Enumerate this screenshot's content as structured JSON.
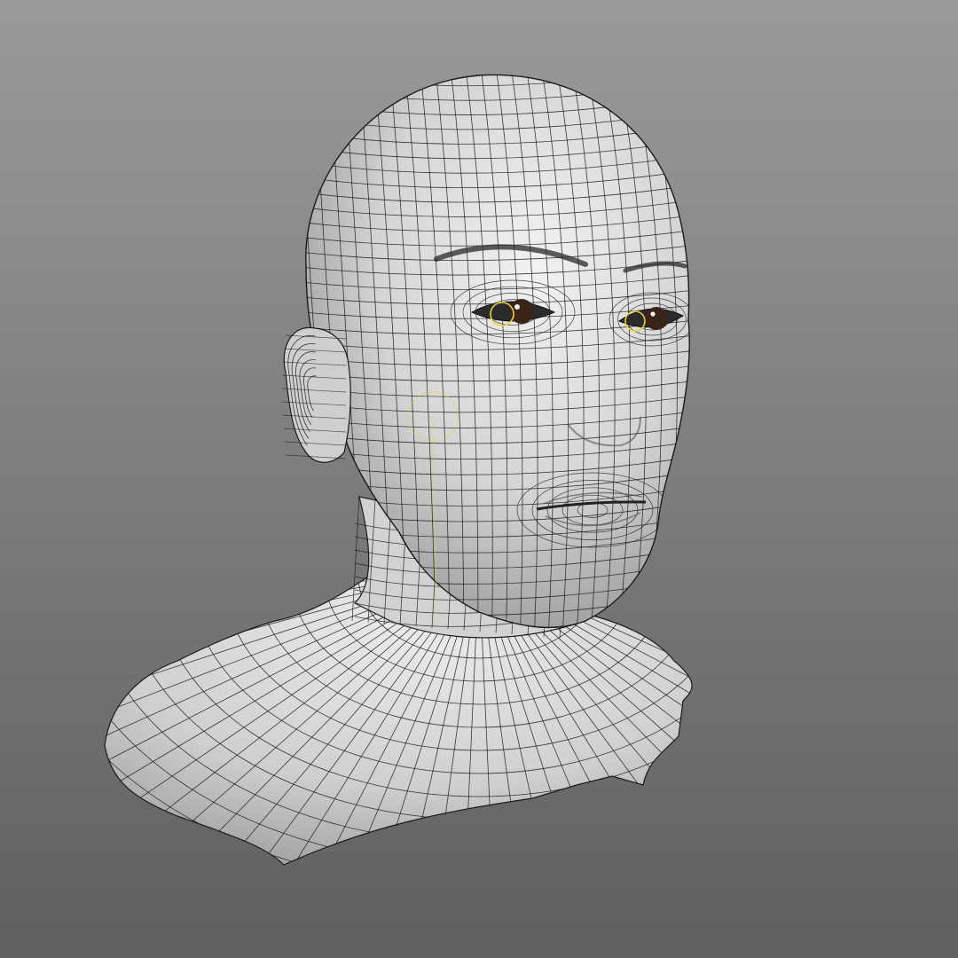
{
  "viewport": {
    "background_top": "#9a9a9a",
    "background_bottom": "#5f5f5f"
  },
  "model": {
    "object": "wireframe-head-bust",
    "shading": "smooth-shaded-with-wireframe",
    "surface_color": "#dcdcdc",
    "surface_shadow": "#8f8f8f",
    "wire_color": "#1a1a1a",
    "eye_iris_color": "#3a2418",
    "selection_color": "#e8d23a"
  }
}
